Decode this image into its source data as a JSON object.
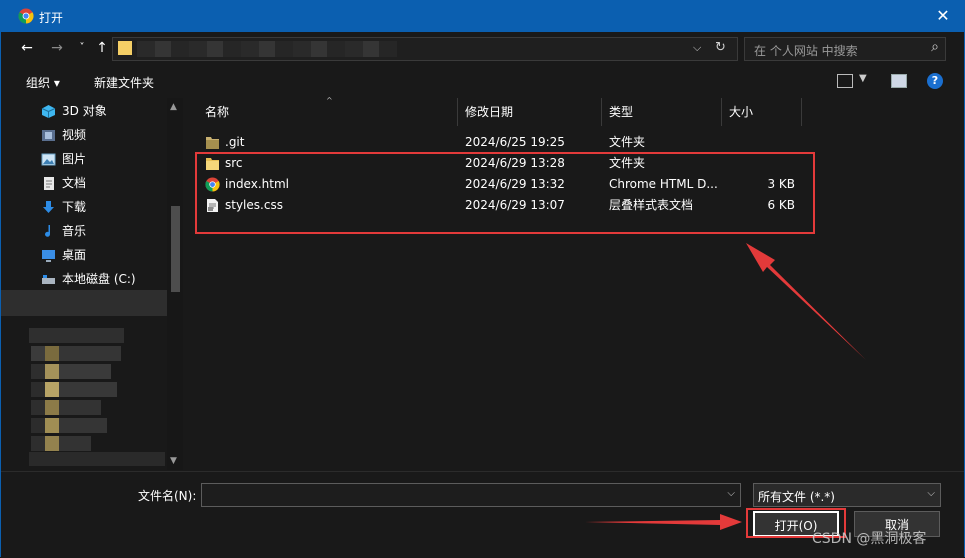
{
  "window": {
    "title": "打开",
    "close_glyph": "✕",
    "app_icon": "chrome-icon"
  },
  "nav": {
    "back": "←",
    "forward": "→",
    "recent": "˅",
    "up": "↑",
    "address_dropdown": "⌵",
    "refresh": "↻",
    "search_placeholder": "在 个人网站 中搜索",
    "search_icon": "⌕"
  },
  "toolbar": {
    "organize": "组织 ▾",
    "new_folder": "新建文件夹",
    "help": "?"
  },
  "sidebar": {
    "items": [
      {
        "label": "3D 对象",
        "icon": "cube-icon",
        "color": "#3fb7f0"
      },
      {
        "label": "视频",
        "icon": "video-icon",
        "color": "#8aa4c8"
      },
      {
        "label": "图片",
        "icon": "pictures-icon",
        "color": "#8fc6ea"
      },
      {
        "label": "文档",
        "icon": "documents-icon",
        "color": "#d9d9d9"
      },
      {
        "label": "下载",
        "icon": "download-icon",
        "color": "#2d8ce6"
      },
      {
        "label": "音乐",
        "icon": "music-icon",
        "color": "#2d8ce6"
      },
      {
        "label": "桌面",
        "icon": "desktop-icon",
        "color": "#3a8ee6"
      },
      {
        "label": "本地磁盘 (C:)",
        "icon": "drive-icon",
        "color": "#9ab"
      }
    ]
  },
  "columns": {
    "name": "名称",
    "modified": "修改日期",
    "type": "类型",
    "size": "大小"
  },
  "files": [
    {
      "name": ".git",
      "date": "2024/6/25 19:25",
      "type": "文件夹",
      "size": "",
      "icon": "folder-icon"
    },
    {
      "name": "src",
      "date": "2024/6/29 13:28",
      "type": "文件夹",
      "size": "",
      "icon": "folder-icon"
    },
    {
      "name": "index.html",
      "date": "2024/6/29 13:32",
      "type": "Chrome HTML D...",
      "size": "3 KB",
      "icon": "chrome-html-icon"
    },
    {
      "name": "styles.css",
      "date": "2024/6/29 13:07",
      "type": "层叠样式表文档",
      "size": "6 KB",
      "icon": "css-file-icon"
    }
  ],
  "footer": {
    "filename_label": "文件名(N):",
    "filename_value": "",
    "filetype": "所有文件 (*.*)",
    "open": "打开(O)",
    "cancel": "取消",
    "dropdown": "⌵"
  },
  "watermark": "CSDN @黑洞极客",
  "colors": {
    "accent": "#0b5fb0",
    "highlight": "#e33a3a",
    "background": "#191919"
  }
}
